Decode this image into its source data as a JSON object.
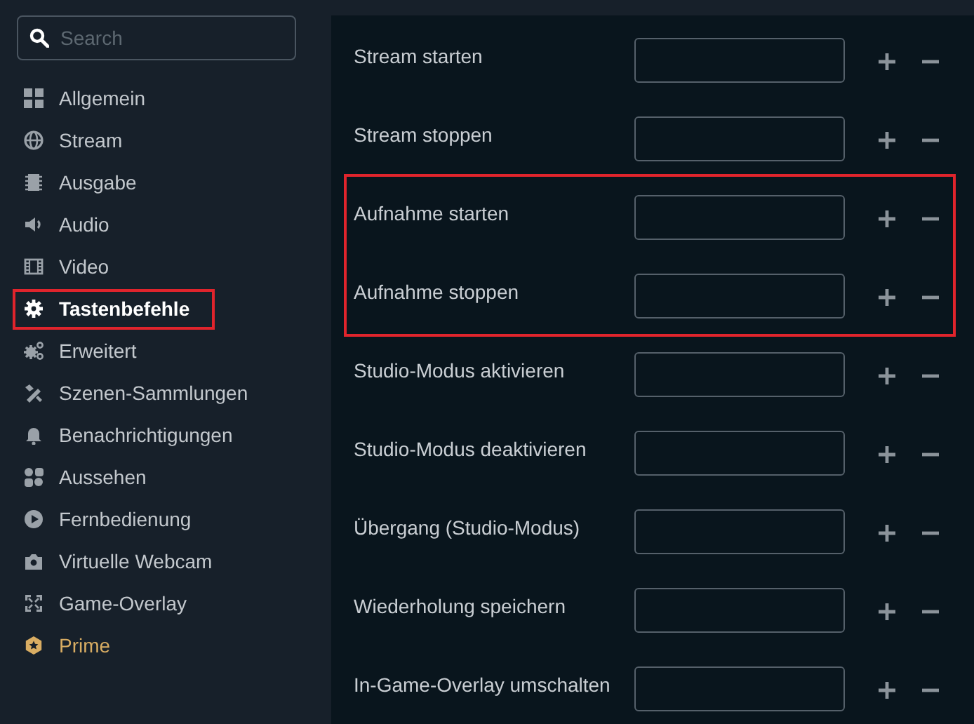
{
  "search": {
    "placeholder": "Search"
  },
  "sidebar": {
    "items": [
      {
        "label": "Allgemein",
        "kind": "grid",
        "selected": false,
        "highlighted": false
      },
      {
        "label": "Stream",
        "kind": "globe",
        "selected": false,
        "highlighted": false
      },
      {
        "label": "Ausgabe",
        "kind": "chip",
        "selected": false,
        "highlighted": false
      },
      {
        "label": "Audio",
        "kind": "speaker",
        "selected": false,
        "highlighted": false
      },
      {
        "label": "Video",
        "kind": "film",
        "selected": false,
        "highlighted": false
      },
      {
        "label": "Tastenbefehle",
        "kind": "gear",
        "selected": true,
        "highlighted": true
      },
      {
        "label": "Erweitert",
        "kind": "gears",
        "selected": false,
        "highlighted": false
      },
      {
        "label": "Szenen-Sammlungen",
        "kind": "tools",
        "selected": false,
        "highlighted": false
      },
      {
        "label": "Benachrichtigungen",
        "kind": "bell",
        "selected": false,
        "highlighted": false
      },
      {
        "label": "Aussehen",
        "kind": "shapes",
        "selected": false,
        "highlighted": false
      },
      {
        "label": "Fernbedienung",
        "kind": "play",
        "selected": false,
        "highlighted": false
      },
      {
        "label": "Virtuelle Webcam",
        "kind": "camera",
        "selected": false,
        "highlighted": false
      },
      {
        "label": "Game-Overlay",
        "kind": "expand",
        "selected": false,
        "highlighted": false
      },
      {
        "label": "Prime",
        "kind": "prime",
        "selected": false,
        "highlighted": false
      }
    ]
  },
  "hotkeys": [
    {
      "label": "Stream starten",
      "highlighted": false
    },
    {
      "label": "Stream stoppen",
      "highlighted": false
    },
    {
      "label": "Aufnahme starten",
      "highlighted": true
    },
    {
      "label": "Aufnahme stoppen",
      "highlighted": true
    },
    {
      "label": "Studio-Modus aktivieren",
      "highlighted": false
    },
    {
      "label": "Studio-Modus deaktivieren",
      "highlighted": false
    },
    {
      "label": "Übergang (Studio-Modus)",
      "highlighted": false
    },
    {
      "label": "Wiederholung speichern",
      "highlighted": false
    },
    {
      "label": "In-Game-Overlay umschalten",
      "highlighted": false
    }
  ]
}
